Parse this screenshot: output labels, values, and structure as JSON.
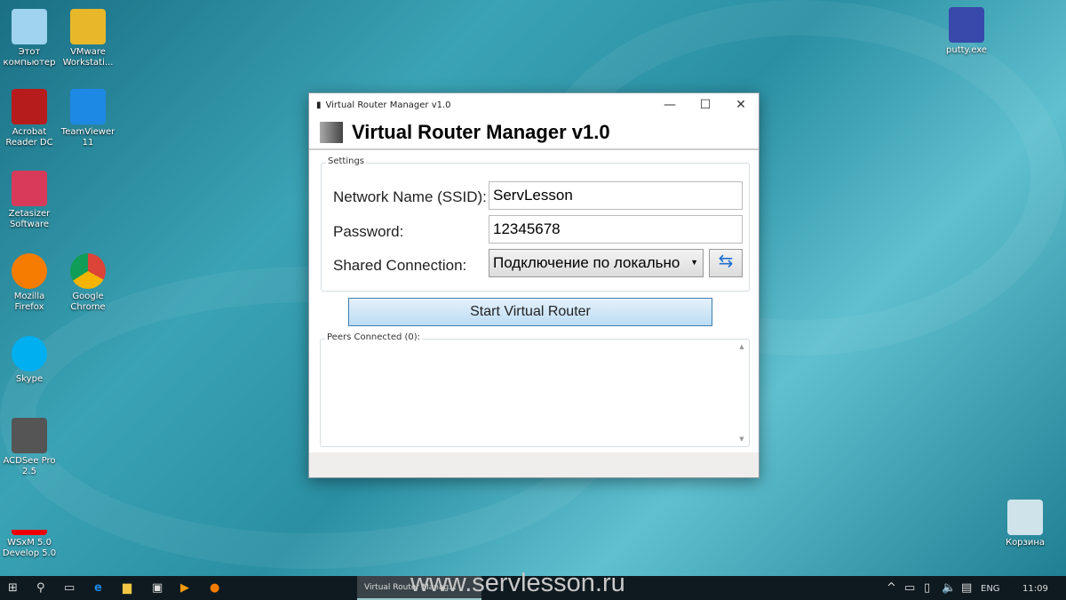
{
  "desktop": {
    "icons_left": [
      "Этот компьютер",
      "VMware Workstati...",
      "Acrobat Reader DC",
      "TeamViewer 11",
      "Zetasizer Software",
      "Mozilla Firefox",
      "Google Chrome",
      "Skype",
      "ACDSee Pro 2.5",
      "WSxM 5.0 Develop 5.0"
    ],
    "icons_right": [
      "putty.exe",
      "Корзина"
    ]
  },
  "window": {
    "title": "Virtual Router Manager v1.0",
    "header": "Virtual Router Manager v1.0",
    "settings_label": "Settings",
    "ssid_label": "Network Name (SSID):",
    "ssid_value": "ServLesson",
    "password_label": "Password:",
    "password_value": "12345678",
    "shared_label": "Shared Connection:",
    "shared_value": "Подключение по локально",
    "start_button": "Start Virtual Router",
    "peers_label": "Peers Connected (0):"
  },
  "taskbar": {
    "window_label": "Virtual Router Manag...",
    "watermark": "www.servlesson.ru",
    "lang": "ENG",
    "time": "11:09"
  }
}
